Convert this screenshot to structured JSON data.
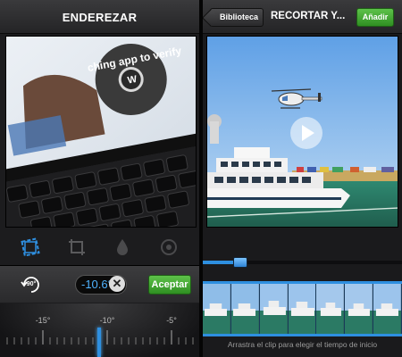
{
  "left": {
    "title": "ENDEREZAR",
    "photo_caption": "ching app to verify",
    "tools": [
      {
        "icon": "straighten-icon",
        "active": true
      },
      {
        "icon": "crop-icon",
        "active": false
      },
      {
        "icon": "drop-icon",
        "active": false
      },
      {
        "icon": "lens-icon",
        "active": false
      }
    ],
    "rotate_label": "90°",
    "angle_value": "-10.6°",
    "clear_symbol": "✕",
    "accept_label": "Aceptar",
    "ruler_labels": [
      "-15°",
      "-10°",
      "-5°"
    ],
    "accent_color": "#2e8fe0"
  },
  "right": {
    "back_label": "Biblioteca",
    "title": "RECORTAR Y...",
    "add_label": "Añadir",
    "hint": "Arrastra el clip para elegir el tiempo de inicio",
    "accent_color": "#2e8fe0",
    "button_color": "#3fa833"
  }
}
